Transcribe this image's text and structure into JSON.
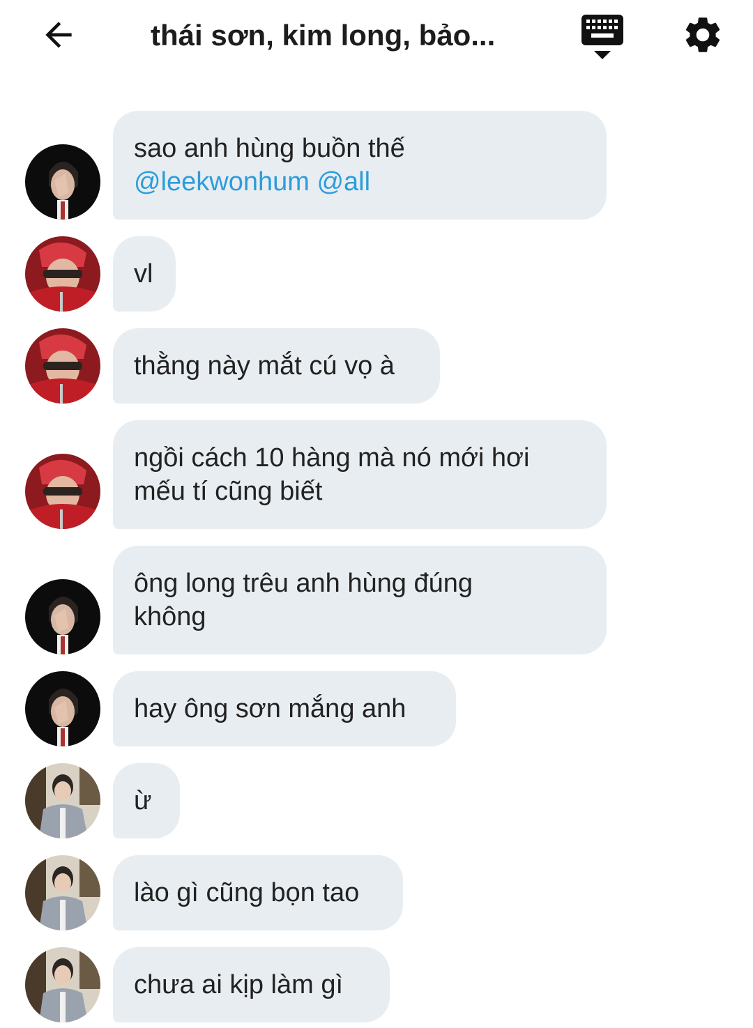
{
  "header": {
    "title": "thái sơn, kim long, bảo...",
    "back_icon": "arrow-left-icon",
    "keyboard_icon": "keyboard-hide-icon",
    "settings_icon": "gear-icon"
  },
  "colors": {
    "bubble_bg": "#e8edf1",
    "mention": "#2d9cdb",
    "text": "#222222"
  },
  "messages": [
    {
      "avatar": "avatar-dark-hair-hand-face",
      "line1": "sao anh hùng buồn thế",
      "mentions": "@leekwonhum @all"
    },
    {
      "avatar": "avatar-red-hair-sunglasses",
      "line1": "vl"
    },
    {
      "avatar": "avatar-red-hair-sunglasses",
      "line1": "thằng này mắt cú vọ à"
    },
    {
      "avatar": "avatar-red-hair-sunglasses",
      "line1": "ngồi cách 10 hàng mà nó mới hơi",
      "line2": "mếu tí cũng biết"
    },
    {
      "avatar": "avatar-dark-hair-hand-face",
      "line1": "ông long trêu anh hùng đúng",
      "line2": "không"
    },
    {
      "avatar": "avatar-dark-hair-hand-face",
      "line1": "hay ông sơn mắng anh"
    },
    {
      "avatar": "avatar-grey-cardigan",
      "line1": "ừ"
    },
    {
      "avatar": "avatar-grey-cardigan",
      "line1": "lào gì cũng bọn tao"
    },
    {
      "avatar": "avatar-grey-cardigan",
      "line1": "chưa ai kịp làm gì"
    }
  ]
}
